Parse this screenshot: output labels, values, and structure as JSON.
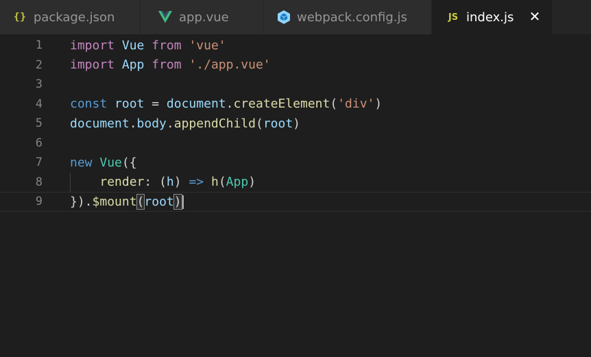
{
  "tabs": [
    {
      "icon": "{}",
      "label": "package.json"
    },
    {
      "icon": "vue",
      "label": "app.vue"
    },
    {
      "icon": "webpack",
      "label": "webpack.config.js"
    },
    {
      "icon": "JS",
      "label": "index.js",
      "close": "✕"
    }
  ],
  "line_numbers": [
    "1",
    "2",
    "3",
    "4",
    "5",
    "6",
    "7",
    "8",
    "9"
  ],
  "code": {
    "l1": {
      "import": "import",
      "name": "Vue",
      "from": "from",
      "str": "'vue'"
    },
    "l2": {
      "import": "import",
      "name": "App",
      "from": "from",
      "str": "'./app.vue'"
    },
    "l4": {
      "const": "const",
      "name": "root",
      "eq": "=",
      "obj": "document",
      "dot": ".",
      "fn": "createElement",
      "open": "(",
      "str": "'div'",
      "close": ")"
    },
    "l5": {
      "obj": "document",
      "dot1": ".",
      "prop": "body",
      "dot2": ".",
      "fn": "appendChild",
      "open": "(",
      "arg": "root",
      "close": ")"
    },
    "l7": {
      "new": "new",
      "cls": "Vue",
      "open": "({"
    },
    "l8": {
      "indent": "    ",
      "fn": "render",
      "colon": ": ",
      "open": "(",
      "arg": "h",
      "close": ") ",
      "arrow": "=>",
      "sp": " ",
      "call": "h",
      "open2": "(",
      "arg2": "App",
      "close2": ")"
    },
    "l9": {
      "close": "}).",
      "fn": "$mount",
      "open": "(",
      "arg": "root",
      "closeparen": ")"
    }
  },
  "colors": {
    "background": "#1e1e1e",
    "keyword_import": "#c586c0",
    "keyword_storage": "#569cd6",
    "class_name": "#4ec9b0",
    "string": "#ce9178",
    "variable": "#9cdcfe",
    "function": "#dcdcaa",
    "vue_green": "#41b883",
    "webpack_blue": "#8ed6fb",
    "json_yellow": "#cbcb41"
  }
}
